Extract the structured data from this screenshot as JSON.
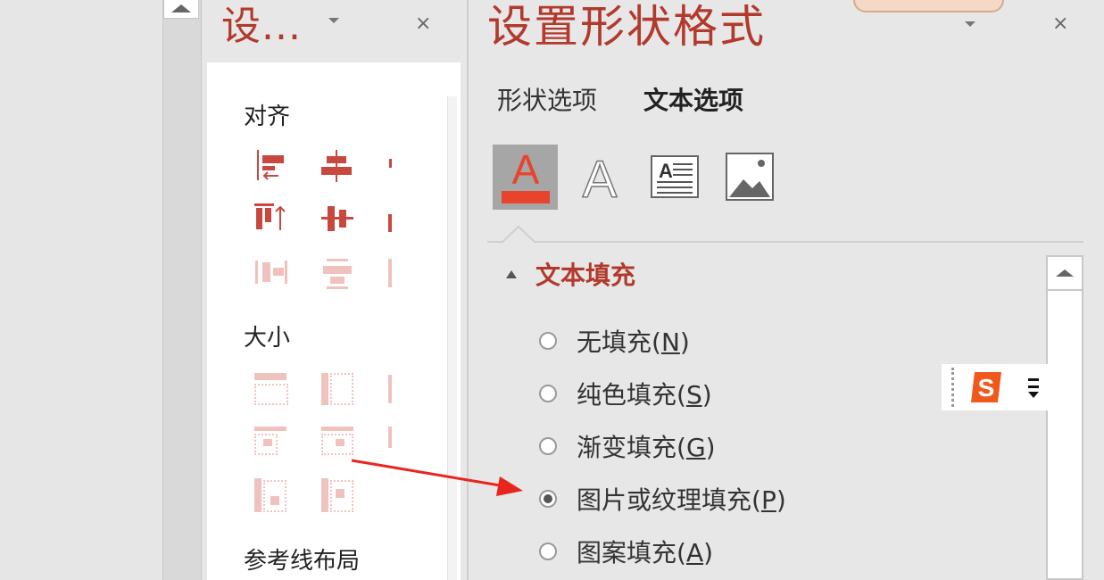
{
  "left_panel": {
    "scroll_up_icon": "triangle-up-icon"
  },
  "middle_panel": {
    "title": "设...",
    "dropdown_icon": "chevron-down-icon",
    "close": "×",
    "sections": {
      "align": "对齐",
      "size": "大小",
      "guides": "参考线布局"
    }
  },
  "right_panel": {
    "title": "设置形状格式",
    "close": "×",
    "tabs": [
      "形状选项",
      "文本选项"
    ],
    "active_tab": "文本选项",
    "tool_icons": [
      "text-fill-outline-icon",
      "text-effects-icon",
      "textbox-icon",
      "picture-icon"
    ],
    "section_title": "文本填充",
    "options": [
      {
        "text": "无填充(",
        "key": "N",
        "end": ")",
        "selected": false
      },
      {
        "text": "纯色填充(",
        "key": "S",
        "end": ")",
        "selected": false
      },
      {
        "text": "渐变填充(",
        "key": "G",
        "end": ")",
        "selected": false
      },
      {
        "text": "图片或纹理填充(",
        "key": "P",
        "end": ")",
        "selected": true
      },
      {
        "text": "图案填充(",
        "key": "A",
        "end": ")",
        "selected": false
      }
    ]
  },
  "colors": {
    "accent": "#b23a2c",
    "icon_red": "#c8473f",
    "icon_faded": "#f0c2be",
    "arrow": "#e8251d",
    "ime_orange": "#f0581c"
  }
}
